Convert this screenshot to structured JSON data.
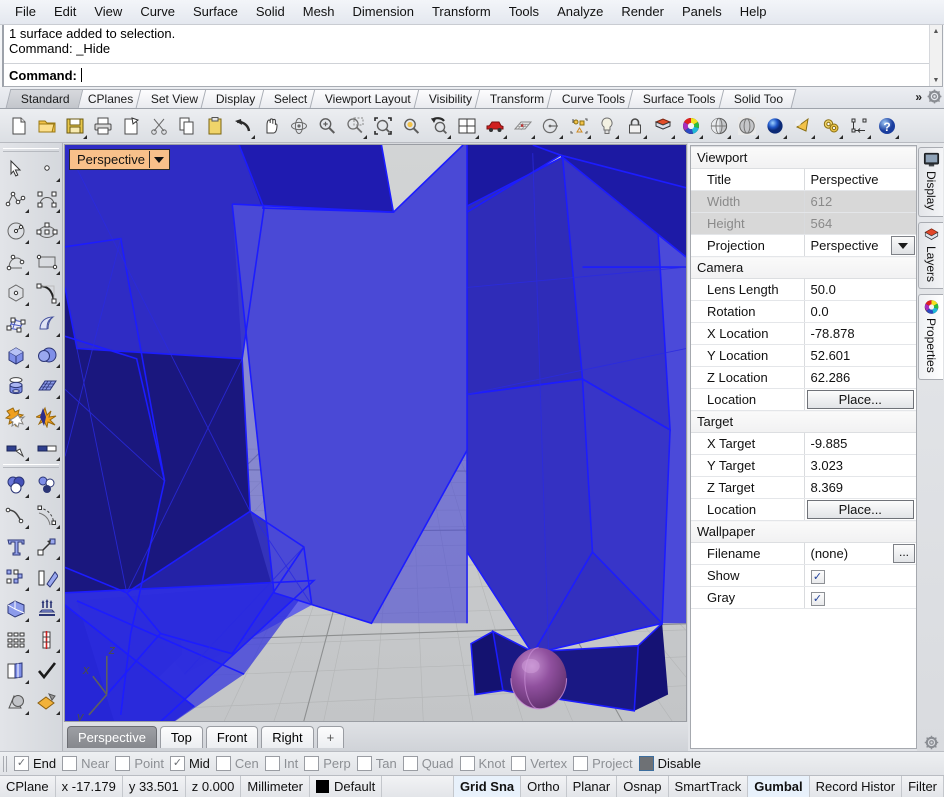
{
  "app": {
    "title": "Rhinoceros"
  },
  "menubar": {
    "items": [
      {
        "label": "File"
      },
      {
        "label": "Edit"
      },
      {
        "label": "View"
      },
      {
        "label": "Curve"
      },
      {
        "label": "Surface"
      },
      {
        "label": "Solid"
      },
      {
        "label": "Mesh"
      },
      {
        "label": "Dimension"
      },
      {
        "label": "Transform"
      },
      {
        "label": "Tools"
      },
      {
        "label": "Analyze"
      },
      {
        "label": "Render"
      },
      {
        "label": "Panels"
      },
      {
        "label": "Help"
      }
    ]
  },
  "command": {
    "history_line_1": "1 surface added to selection.",
    "history_line_2": "Command: _Hide",
    "prompt_label": "Command:",
    "input_value": ""
  },
  "toolbar_tabs": {
    "items": [
      {
        "label": "Standard",
        "active": true
      },
      {
        "label": "CPlanes",
        "active": false
      },
      {
        "label": "Set View",
        "active": false
      },
      {
        "label": "Display",
        "active": false
      },
      {
        "label": "Select",
        "active": false
      },
      {
        "label": "Viewport Layout",
        "active": false
      },
      {
        "label": "Visibility",
        "active": false
      },
      {
        "label": "Transform",
        "active": false
      },
      {
        "label": "Curve Tools",
        "active": false
      },
      {
        "label": "Surface Tools",
        "active": false
      },
      {
        "label": "Solid Too",
        "active": false
      }
    ],
    "overflow_label": "»",
    "options_icon": "gear-icon"
  },
  "main_toolbar": {
    "buttons": [
      {
        "icon": "new-file-icon",
        "flyout": false
      },
      {
        "icon": "open-folder-icon",
        "flyout": false
      },
      {
        "icon": "save-disk-icon",
        "flyout": true
      },
      {
        "icon": "print-icon",
        "flyout": false
      },
      {
        "icon": "cut-paste-icon",
        "flyout": false
      },
      {
        "icon": "scissors-cut-icon",
        "flyout": false
      },
      {
        "icon": "copy-icon",
        "flyout": false
      },
      {
        "icon": "clipboard-paste-icon",
        "flyout": false
      },
      {
        "icon": "undo-arrow-icon",
        "flyout": true
      },
      {
        "icon": "pan-hand-icon",
        "flyout": false
      },
      {
        "icon": "rotate-view-icon",
        "flyout": false
      },
      {
        "icon": "zoom-in-icon",
        "flyout": false
      },
      {
        "icon": "zoom-window-icon",
        "flyout": true
      },
      {
        "icon": "zoom-extents-icon",
        "flyout": false
      },
      {
        "icon": "zoom-selected-icon",
        "flyout": false
      },
      {
        "icon": "zoom-previous-icon",
        "flyout": true
      },
      {
        "icon": "viewport-layout-icon",
        "flyout": true
      },
      {
        "icon": "car-render-icon",
        "flyout": true
      },
      {
        "icon": "mesh-grid-icon",
        "flyout": true
      },
      {
        "icon": "circle-center-icon",
        "flyout": true
      },
      {
        "icon": "object-snap-icon",
        "flyout": true
      },
      {
        "icon": "light-bulb-icon",
        "flyout": true
      },
      {
        "icon": "lock-icon",
        "flyout": true
      },
      {
        "icon": "layers-stack-icon",
        "flyout": true
      },
      {
        "icon": "color-wheel-icon",
        "flyout": true
      },
      {
        "icon": "shaded-sphere-icon",
        "flyout": true
      },
      {
        "icon": "ghosted-sphere-icon",
        "flyout": true
      },
      {
        "icon": "rendered-sphere-icon",
        "flyout": true
      },
      {
        "icon": "spotlight-cone-icon",
        "flyout": true
      },
      {
        "icon": "gears-options-icon",
        "flyout": true
      },
      {
        "icon": "dimension-icon",
        "flyout": true
      },
      {
        "icon": "help-question-icon",
        "flyout": true
      }
    ]
  },
  "left_toolbar": {
    "buttons": [
      {
        "icon": "select-arrow-icon"
      },
      {
        "icon": "point-object-icon"
      },
      {
        "icon": "polyline-icon"
      },
      {
        "icon": "curve-control-points-icon"
      },
      {
        "icon": "circle-center-radius-icon"
      },
      {
        "icon": "ellipse-icon"
      },
      {
        "icon": "arc-icon"
      },
      {
        "icon": "rectangle-icon"
      },
      {
        "icon": "polygon-icon"
      },
      {
        "icon": "freeform-curve-icon"
      },
      {
        "icon": "surface-control-points-icon"
      },
      {
        "icon": "extrude-surface-icon"
      },
      {
        "icon": "box-solid-icon"
      },
      {
        "icon": "sphere-solid-icon"
      },
      {
        "icon": "cylinder-solid-icon"
      },
      {
        "icon": "mesh-plane-icon"
      },
      {
        "icon": "boolean-union-icon"
      },
      {
        "icon": "explode-icon"
      },
      {
        "icon": "trim-icon"
      },
      {
        "icon": "split-icon"
      },
      {
        "icon": "booleans-spheres-icon"
      },
      {
        "icon": "points-circles-icon"
      },
      {
        "icon": "fillet-curve-icon"
      },
      {
        "icon": "offset-curve-icon"
      },
      {
        "icon": "text-tool-icon"
      },
      {
        "icon": "scale-icon"
      },
      {
        "icon": "array-icon"
      },
      {
        "icon": "mirror-icon"
      },
      {
        "icon": "unroll-surface-icon"
      },
      {
        "icon": "extrude-up-icon"
      },
      {
        "icon": "grid-array-icon"
      },
      {
        "icon": "section-tool-icon"
      },
      {
        "icon": "layer-book-icon"
      },
      {
        "icon": "check-analyze-icon"
      },
      {
        "icon": "render-shapes-icon"
      },
      {
        "icon": "render-material-icon"
      }
    ]
  },
  "viewport": {
    "title": "Perspective",
    "axis_labels": {
      "x": "x",
      "y": "y",
      "z": "z"
    },
    "tabs": [
      {
        "label": "Perspective",
        "active": true
      },
      {
        "label": "Top",
        "active": false
      },
      {
        "label": "Front",
        "active": false
      },
      {
        "label": "Right",
        "active": false
      },
      {
        "label": "+",
        "active": false
      }
    ]
  },
  "properties_panel": {
    "groups": [
      {
        "name": "Viewport",
        "rows": [
          {
            "label": "Title",
            "value": "Perspective",
            "kind": "text",
            "readonly": false
          },
          {
            "label": "Width",
            "value": "612",
            "kind": "text",
            "readonly": true
          },
          {
            "label": "Height",
            "value": "564",
            "kind": "text",
            "readonly": true
          },
          {
            "label": "Projection",
            "value": "Perspective",
            "kind": "dropdown",
            "readonly": false
          }
        ]
      },
      {
        "name": "Camera",
        "rows": [
          {
            "label": "Lens Length",
            "value": "50.0",
            "kind": "text",
            "readonly": false
          },
          {
            "label": "Rotation",
            "value": "0.0",
            "kind": "text",
            "readonly": false
          },
          {
            "label": "X Location",
            "value": "-78.878",
            "kind": "text",
            "readonly": false
          },
          {
            "label": "Y Location",
            "value": "52.601",
            "kind": "text",
            "readonly": false
          },
          {
            "label": "Z Location",
            "value": "62.286",
            "kind": "text",
            "readonly": false
          },
          {
            "label": "Location",
            "value": "Place...",
            "kind": "button",
            "readonly": false
          }
        ]
      },
      {
        "name": "Target",
        "rows": [
          {
            "label": "X Target",
            "value": "-9.885",
            "kind": "text",
            "readonly": false
          },
          {
            "label": "Y Target",
            "value": "3.023",
            "kind": "text",
            "readonly": false
          },
          {
            "label": "Z Target",
            "value": "8.369",
            "kind": "text",
            "readonly": false
          },
          {
            "label": "Location",
            "value": "Place...",
            "kind": "button",
            "readonly": false
          }
        ]
      },
      {
        "name": "Wallpaper",
        "rows": [
          {
            "label": "Filename",
            "value": "(none)",
            "kind": "browse",
            "browse_label": "...",
            "readonly": false
          },
          {
            "label": "Show",
            "value": "",
            "kind": "checkbox",
            "checked": true,
            "readonly": false
          },
          {
            "label": "Gray",
            "value": "",
            "kind": "checkbox",
            "checked": true,
            "readonly": false
          }
        ]
      }
    ]
  },
  "side_tabs": {
    "items": [
      {
        "label": "Display",
        "icon": "monitor-icon",
        "selected": false
      },
      {
        "label": "Layers",
        "icon": "layers-icon",
        "selected": false
      },
      {
        "label": "Properties",
        "icon": "color-wheel-icon",
        "selected": true
      }
    ],
    "settings_icon": "gear-icon"
  },
  "osnap_bar": {
    "items": [
      {
        "label": "End",
        "checked": true
      },
      {
        "label": "Near",
        "checked": false
      },
      {
        "label": "Point",
        "checked": false
      },
      {
        "label": "Mid",
        "checked": true
      },
      {
        "label": "Cen",
        "checked": false
      },
      {
        "label": "Int",
        "checked": false
      },
      {
        "label": "Perp",
        "checked": false
      },
      {
        "label": "Tan",
        "checked": false
      },
      {
        "label": "Quad",
        "checked": false
      },
      {
        "label": "Knot",
        "checked": false
      },
      {
        "label": "Vertex",
        "checked": false
      },
      {
        "label": "Project",
        "checked": false
      },
      {
        "label": "Disable",
        "checked": false,
        "filled": true
      }
    ],
    "check_glyph": "✓"
  },
  "status_bar": {
    "cplane_label": "CPlane",
    "x": "x -17.179",
    "y": "y 33.501",
    "z": "z 0.000",
    "units": "Millimeter",
    "layer": "Default",
    "layer_color": "#000000",
    "toggles": [
      {
        "label": "Grid Sna",
        "active": true
      },
      {
        "label": "Ortho",
        "active": false
      },
      {
        "label": "Planar",
        "active": false
      },
      {
        "label": "Osnap",
        "active": false
      },
      {
        "label": "SmartTrack",
        "active": false
      },
      {
        "label": "Gumbal",
        "active": true
      },
      {
        "label": "Record Histor",
        "active": false
      },
      {
        "label": "Filter",
        "active": false
      }
    ]
  },
  "scene": {
    "description": "Blue faceted polygonal surfaces (selected, shaded blue) standing on a gray construction grid plane, with a small purple ellipsoid object at the base.",
    "colors": {
      "ground": "#c8cacb",
      "grid_minor": "#b3b5b6",
      "grid_major": "#8d8f90",
      "surface_light": "#4a49d6",
      "surface_mid": "#3a36c8",
      "surface_dark": "#2522a8",
      "surface_darkest": "#1a1780",
      "edge": "#1c1cff",
      "purple_object": "#8b4f9b"
    }
  }
}
